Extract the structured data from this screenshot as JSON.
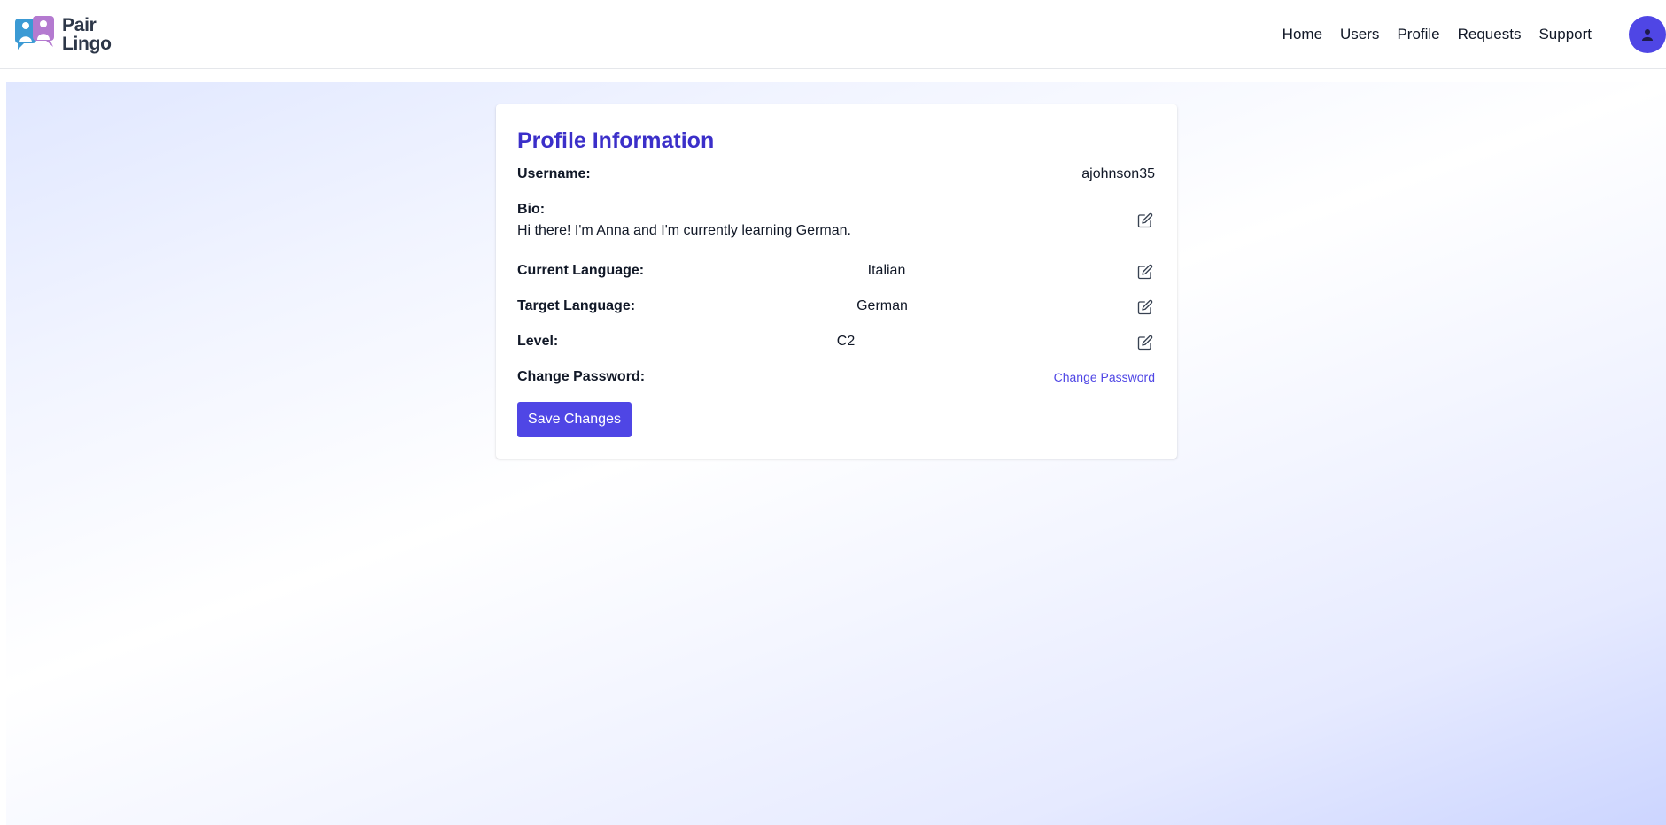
{
  "brand": {
    "line1": "Pair",
    "line2": "Lingo"
  },
  "nav": {
    "items": [
      {
        "label": "Home"
      },
      {
        "label": "Users"
      },
      {
        "label": "Profile"
      },
      {
        "label": "Requests"
      },
      {
        "label": "Support"
      }
    ]
  },
  "profile": {
    "title": "Profile Information",
    "username_label": "Username:",
    "username_value": "ajohnson35",
    "bio_label": "Bio:",
    "bio_value": "Hi there! I'm Anna and I'm currently learning German.",
    "current_language_label": "Current Language:",
    "current_language_value": "Italian",
    "target_language_label": "Target Language:",
    "target_language_value": "German",
    "level_label": "Level:",
    "level_value": "C2",
    "change_password_label": "Change Password:",
    "change_password_link": "Change Password",
    "save_button": "Save Changes"
  },
  "icons": {
    "logo": "pair-lingo-logo-icon",
    "avatar": "user-icon",
    "edit": "edit-icon"
  },
  "colors": {
    "accent": "#4f46e5",
    "title": "#3b2fc9",
    "text": "#111827",
    "background_gradient_start": "#e0e7ff",
    "background_gradient_end": "#ccd5ff"
  }
}
